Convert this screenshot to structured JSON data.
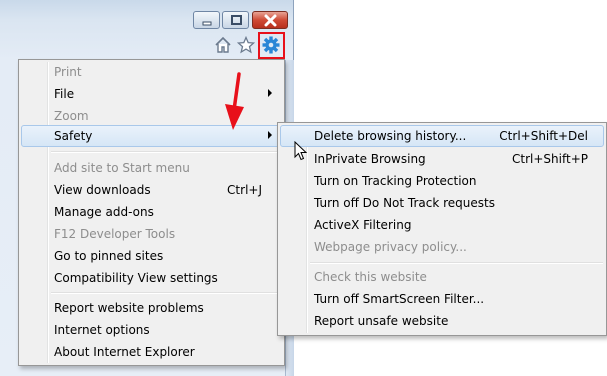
{
  "window": {
    "caption_buttons": [
      "minimize-icon",
      "maximize-icon",
      "close-icon"
    ],
    "toolbar_icons": [
      "home-icon",
      "favorites-star-icon",
      "tools-gear-icon"
    ],
    "accent_colors": {
      "highlight_box": "#e8101a",
      "close_button": "#cf4b36",
      "menu_hover": "#d6e6f6"
    }
  },
  "menu": {
    "items": [
      {
        "label": "Print",
        "disabled": true
      },
      {
        "label": "File",
        "submenu": true
      },
      {
        "label": "Zoom",
        "disabled": true
      },
      {
        "label": "Safety",
        "submenu": true,
        "highlighted": true
      },
      {
        "label": "Add site to Start menu",
        "disabled": true
      },
      {
        "label": "View downloads",
        "shortcut": "Ctrl+J"
      },
      {
        "label": "Manage add-ons"
      },
      {
        "label": "F12 Developer Tools",
        "disabled": true
      },
      {
        "label": "Go to pinned sites"
      },
      {
        "label": "Compatibility View settings"
      },
      {
        "label": "Report website problems"
      },
      {
        "label": "Internet options"
      },
      {
        "label": "About Internet Explorer"
      }
    ]
  },
  "safety_submenu": {
    "items": [
      {
        "label": "Delete browsing history...",
        "shortcut": "Ctrl+Shift+Del",
        "highlighted": true
      },
      {
        "label": "InPrivate Browsing",
        "shortcut": "Ctrl+Shift+P"
      },
      {
        "label": "Turn on Tracking Protection"
      },
      {
        "label": "Turn off Do Not Track requests"
      },
      {
        "label": "ActiveX Filtering"
      },
      {
        "label": "Webpage privacy policy...",
        "disabled": true
      },
      {
        "label": "Check this website",
        "disabled": true
      },
      {
        "label": "Turn off SmartScreen Filter..."
      },
      {
        "label": "Report unsafe website"
      }
    ]
  },
  "annotations": {
    "arrow_color": "#e8101a",
    "arrow_icon": "red-arrow-icon",
    "cursor_icon": "mouse-pointer-icon"
  }
}
